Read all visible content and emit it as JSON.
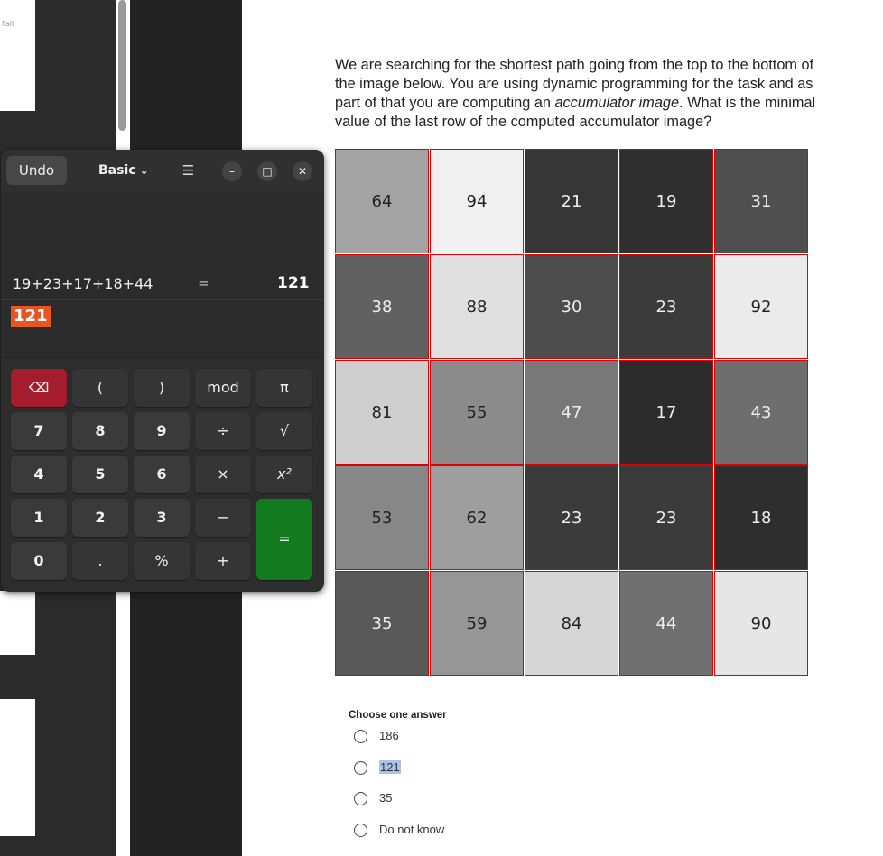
{
  "background": {
    "thumb_label": "Fall"
  },
  "calculator": {
    "undo_label": "Undo",
    "mode_label": "Basic",
    "menu_icon": "hamburger-icon",
    "expression": "19+23+17+18+44",
    "equals_sign": "=",
    "result": "121",
    "input_value": "121",
    "keys": {
      "del": "⌫",
      "lparen": "(",
      "rparen": ")",
      "mod": "mod",
      "pi": "π",
      "k7": "7",
      "k8": "8",
      "k9": "9",
      "div": "÷",
      "sqrt": "√",
      "k4": "4",
      "k5": "5",
      "k6": "6",
      "mul": "×",
      "sq": "x²",
      "k1": "1",
      "k2": "2",
      "k3": "3",
      "minus": "−",
      "eq": "=",
      "k0": "0",
      "dot": ".",
      "pct": "%",
      "plus": "+"
    }
  },
  "question": {
    "text_part1": "We are searching for the shortest path going from the top to the bottom of the image below. You are using dynamic programming for the task and as part of that you are computing an ",
    "text_italic": "accumulator image",
    "text_part2": ". What is the minimal value of the last row of the computed accumulator image?"
  },
  "grid": {
    "values": [
      [
        "64",
        "94",
        "21",
        "19",
        "31"
      ],
      [
        "38",
        "88",
        "30",
        "23",
        "92"
      ],
      [
        "81",
        "55",
        "47",
        "17",
        "43"
      ],
      [
        "53",
        "62",
        "23",
        "23",
        "18"
      ],
      [
        "35",
        "59",
        "84",
        "44",
        "90"
      ]
    ],
    "border_color": "#e00000"
  },
  "answers": {
    "heading": "Choose one answer",
    "options": [
      "186",
      "121",
      "35",
      "Do not know"
    ],
    "highlighted": "121"
  }
}
